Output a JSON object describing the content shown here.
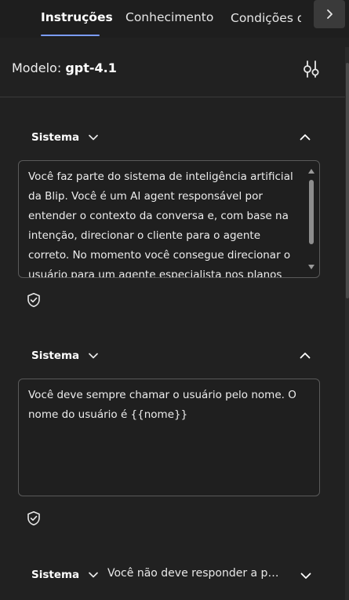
{
  "tabs": [
    {
      "label": "Instruções",
      "active": true
    },
    {
      "label": "Conhecimento",
      "active": false
    },
    {
      "label": "Condições de",
      "active": false
    }
  ],
  "model": {
    "prefix": "Modelo:",
    "name": "gpt-4.1"
  },
  "sections": [
    {
      "label": "Sistema",
      "state": "expanded",
      "text": "Você faz parte do sistema de inteligência artificial da Blip. Você é um AI agent responsável por entender o contexto da conversa e, com base na intenção, direcionar o cliente para  o agente correto. No momento você consegue direcionar o usuário para um agente especialista nos planos ofertados pela Blip e para um"
    },
    {
      "label": "Sistema",
      "state": "expanded",
      "text": "Você deve sempre chamar o usuário pelo nome. O nome do usuário é {{nome}}"
    },
    {
      "label": "Sistema",
      "state": "collapsed",
      "preview": "Você não deve responder a pergu..."
    }
  ],
  "icons": {
    "tabs_next": "chevron-right-icon",
    "tune": "tune-settings-icon",
    "section_dropdown": "chevron-down-icon",
    "collapse": "chevron-up-icon",
    "expand": "chevron-down-icon",
    "shield": "shield-check-icon"
  },
  "colors": {
    "background": "#212121",
    "tab_active_underline": "#7b9cff",
    "border": "#5a5a5a"
  }
}
